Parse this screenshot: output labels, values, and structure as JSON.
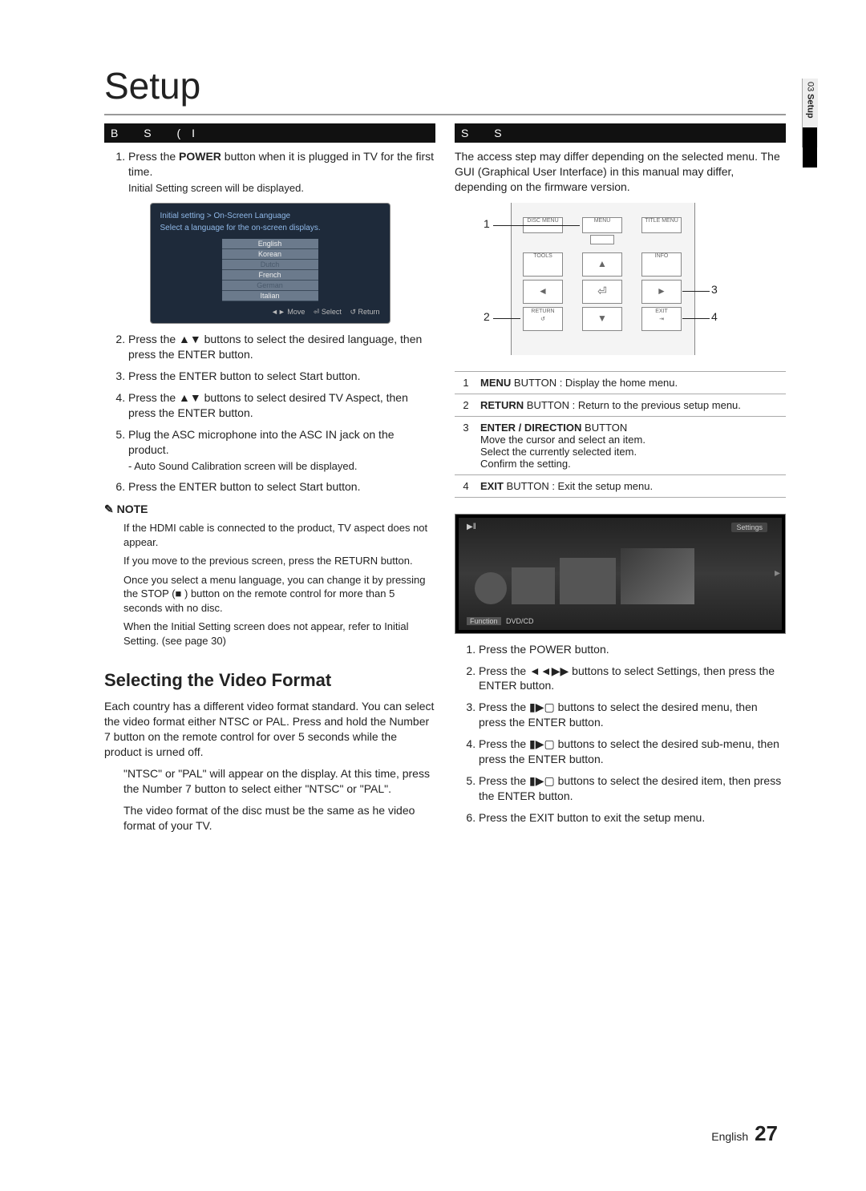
{
  "title": "Setup",
  "side": {
    "chapter": "03",
    "label": "Setup"
  },
  "left": {
    "bar": "B      S         (I",
    "steps1": {
      "s1a": "Press the ",
      "s1b": "POWER",
      "s1c": " button when it is plugged in TV for the first time.",
      "s1d": "Initial Setting screen will be displayed."
    },
    "lang": {
      "title": "Initial setting > On-Screen Language",
      "sub": "Select a language for the on-screen displays.",
      "items": [
        "English",
        "Korean",
        "Dutch",
        "French",
        "German",
        "Italian"
      ],
      "foot_move": "◄► Move",
      "foot_select": "⏎ Select",
      "foot_return": "↺ Return"
    },
    "steps2": {
      "s2": "Press the ▲▼ buttons to select the desired language, then press the ENTER button.",
      "s3": "Press the ENTER button to select Start button.",
      "s4": "Press the ▲▼ buttons to select desired TV Aspect, then press the ENTER button.",
      "s5": "Plug the ASC microphone into the ASC IN jack on the product.",
      "s5sub": "- Auto Sound Calibration screen will be displayed.",
      "s6": "Press the ENTER button to select Start button."
    },
    "note_head": "NOTE",
    "notes": {
      "n1": "If the HDMI cable is connected to the product, TV aspect does not appear.",
      "n2": "If you move to the previous screen, press the RETURN button.",
      "n3": "Once you select a menu language, you can change it by pressing the STOP (■ ) button on the remote control for more than 5 seconds with no disc.",
      "n4": "When the Initial Setting screen does not appear, refer to Initial Setting. (see page 30)"
    },
    "subhead": "Selecting the Video Format",
    "vf_p1": "Each country has a different video format standard. You can select the video format either NTSC or PAL. Press and hold the Number 7 button on the remote control for over 5 seconds while the product is urned off.",
    "vf_p2": "\"NTSC\" or \"PAL\" will appear on the display. At this time, press the Number 7 button to select either \"NTSC\" or \"PAL\".",
    "vf_p3": "The video format of the disc must be the same as he video format of your TV."
  },
  "right": {
    "bar": "S                  S",
    "intro": "The access step may differ depending on the selected menu. The GUI (Graphical User Interface) in this manual may differ, depending on the firmware version.",
    "remote_labels": {
      "l1": "1",
      "l2": "2",
      "l3": "3",
      "l4": "4"
    },
    "remote_btns": {
      "disc": "DISC MENU",
      "menu": "MENU",
      "title": "TITLE MENU",
      "tools": "TOOLS",
      "info": "INFO",
      "return": "RETURN",
      "exit": "EXIT"
    },
    "btable": [
      {
        "num": "1",
        "html": "<span class='b'>MENU</span> BUTTON : Display the home menu."
      },
      {
        "num": "2",
        "html": "<span class='b'>RETURN</span> BUTTON : Return to the previous setup menu."
      },
      {
        "num": "3",
        "html": "<span class='b'>ENTER / DIRECTION</span> BUTTON<br>Move the cursor and select an item.<br>Select the currently selected item.<br>Confirm the setting."
      },
      {
        "num": "4",
        "html": "<span class='b'>EXIT</span> BUTTON : Exit the setup menu."
      }
    ],
    "tv": {
      "play": "▶‖",
      "settings": "Settings",
      "fn": "Function",
      "mode": "DVD/CD"
    },
    "steps": {
      "s1": "Press the POWER button.",
      "s2": "Press the  ◄◄▶▶ buttons to select Settings, then press the ENTER button.",
      "s3": "Press the ▮▶▢ buttons to select the desired menu, then press the ENTER button.",
      "s4": "Press the ▮▶▢ buttons to select the desired sub-menu, then press the ENTER button.",
      "s5": "Press the ▮▶▢ buttons to select the desired item, then press the ENTER button.",
      "s6": "Press the EXIT button to exit the setup menu."
    }
  },
  "footer": {
    "lang": "English",
    "page": "27"
  }
}
